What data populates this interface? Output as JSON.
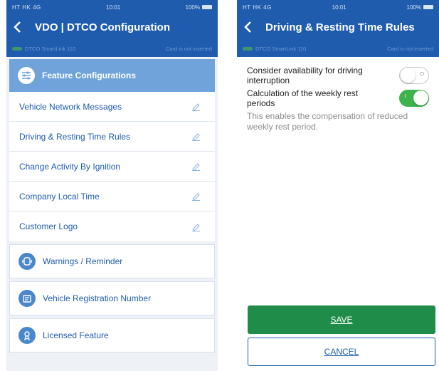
{
  "left": {
    "status": {
      "signal": "HT HK 4G",
      "time": "10:01",
      "battery": "100%"
    },
    "title": "VDO | DTCO Configuration",
    "device": "DTCO SmartLink 110",
    "card_status": "Card is not inserted",
    "feature_header": {
      "label": "Feature Configurations",
      "icon": "sliders-icon"
    },
    "sub_items": [
      {
        "label": "Vehicle Network Messages"
      },
      {
        "label": "Driving & Resting Time Rules"
      },
      {
        "label": "Change Activity By Ignition"
      },
      {
        "label": "Company Local Time"
      },
      {
        "label": "Customer Logo"
      }
    ],
    "cards": [
      {
        "label": "Warnings / Reminder",
        "icon": "warning-icon"
      },
      {
        "label": "Vehicle Registration Number",
        "icon": "registration-icon"
      },
      {
        "label": "Licensed Feature",
        "icon": "license-icon"
      }
    ]
  },
  "right": {
    "status": {
      "signal": "HT HK 4G",
      "time": "10:01",
      "battery": "100%"
    },
    "title": "Driving & Resting Time Rules",
    "device": "DTCO SmartLink 110",
    "card_status": "Card is not inserted",
    "settings": [
      {
        "label": "Consider availability for driving interruption",
        "enabled": false
      },
      {
        "label": "Calculation of the weekly rest periods",
        "enabled": true
      }
    ],
    "description": "This enables the compensation of reduced weekly rest period.",
    "save_label": "SAVE",
    "cancel_label": "CANCEL"
  },
  "colors": {
    "header_blue": "#1f5cae",
    "accent_light_blue": "#6fa3da",
    "save_green": "#1f8c4a",
    "toggle_green": "#3cb44b"
  }
}
